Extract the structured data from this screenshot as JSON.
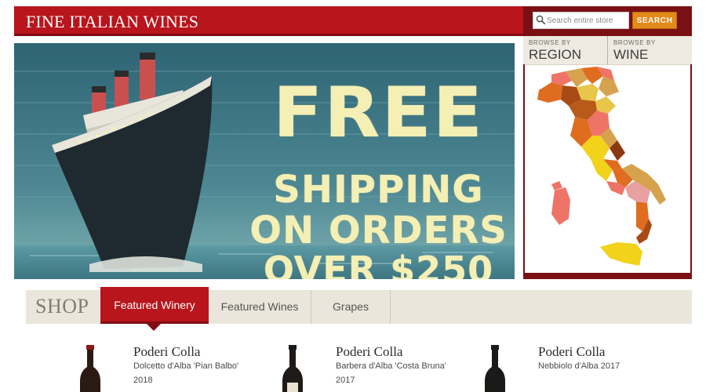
{
  "header": {
    "title": "FINE ITALIAN WINES"
  },
  "search": {
    "placeholder": "Search entire store",
    "button_label": "SEARCH"
  },
  "browse": [
    {
      "small": "BROWSE BY",
      "label": "REGION"
    },
    {
      "small": "BROWSE BY",
      "label": "WINE"
    }
  ],
  "hero": {
    "lines": [
      "FREE",
      "SHIPPING",
      "ON ORDERS",
      "OVER $250"
    ]
  },
  "shop": {
    "label": "SHOP",
    "tabs": [
      {
        "label": "Featured Winery",
        "active": true
      },
      {
        "label": "Featured Wines",
        "active": false
      },
      {
        "label": "Grapes",
        "active": false
      }
    ]
  },
  "products": [
    {
      "producer": "Poderi Colla",
      "wine": "Dolcetto d'Alba 'Pian Balbo'",
      "year": "2018"
    },
    {
      "producer": "Poderi Colla",
      "wine": "Barbera d'Alba 'Costa Bruna'",
      "year": "2017"
    },
    {
      "producer": "Poderi Colla",
      "wine": "Nebbiolo d'Alba 2017",
      "year": ""
    }
  ],
  "colors": {
    "brand_red": "#b8151c",
    "dark_red": "#7a1014",
    "search_orange": "#e38a1b",
    "hero_text": "#f4efb4"
  }
}
